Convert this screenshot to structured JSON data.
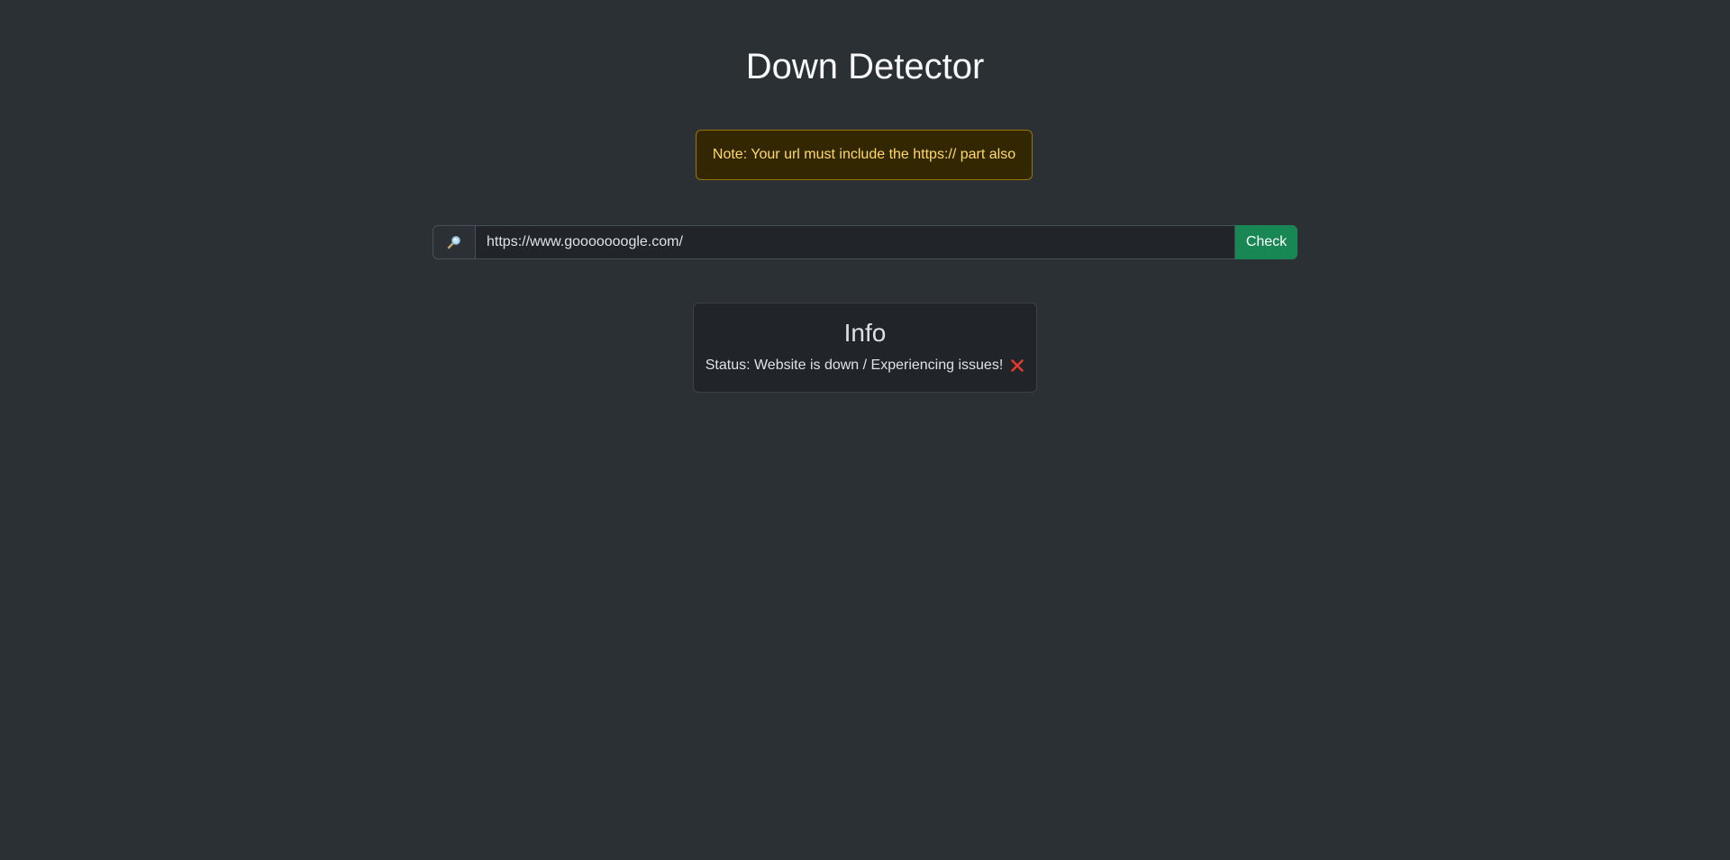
{
  "header": {
    "title": "Down Detector"
  },
  "note": {
    "text": "Note: Your url must include the https:// part also"
  },
  "search": {
    "icon": "magnifying-glass-icon",
    "value": "https://www.gooooooogle.com/",
    "button_label": "Check"
  },
  "info": {
    "title": "Info",
    "status_text": "Status: Website is down / Experiencing issues!",
    "status_icon": "red-x-icon"
  },
  "colors": {
    "background": "#2b3035",
    "warning_bg": "#332701",
    "warning_border": "#997404",
    "warning_text": "#ffda6a",
    "success": "#198754",
    "error": "#e03a2f"
  }
}
